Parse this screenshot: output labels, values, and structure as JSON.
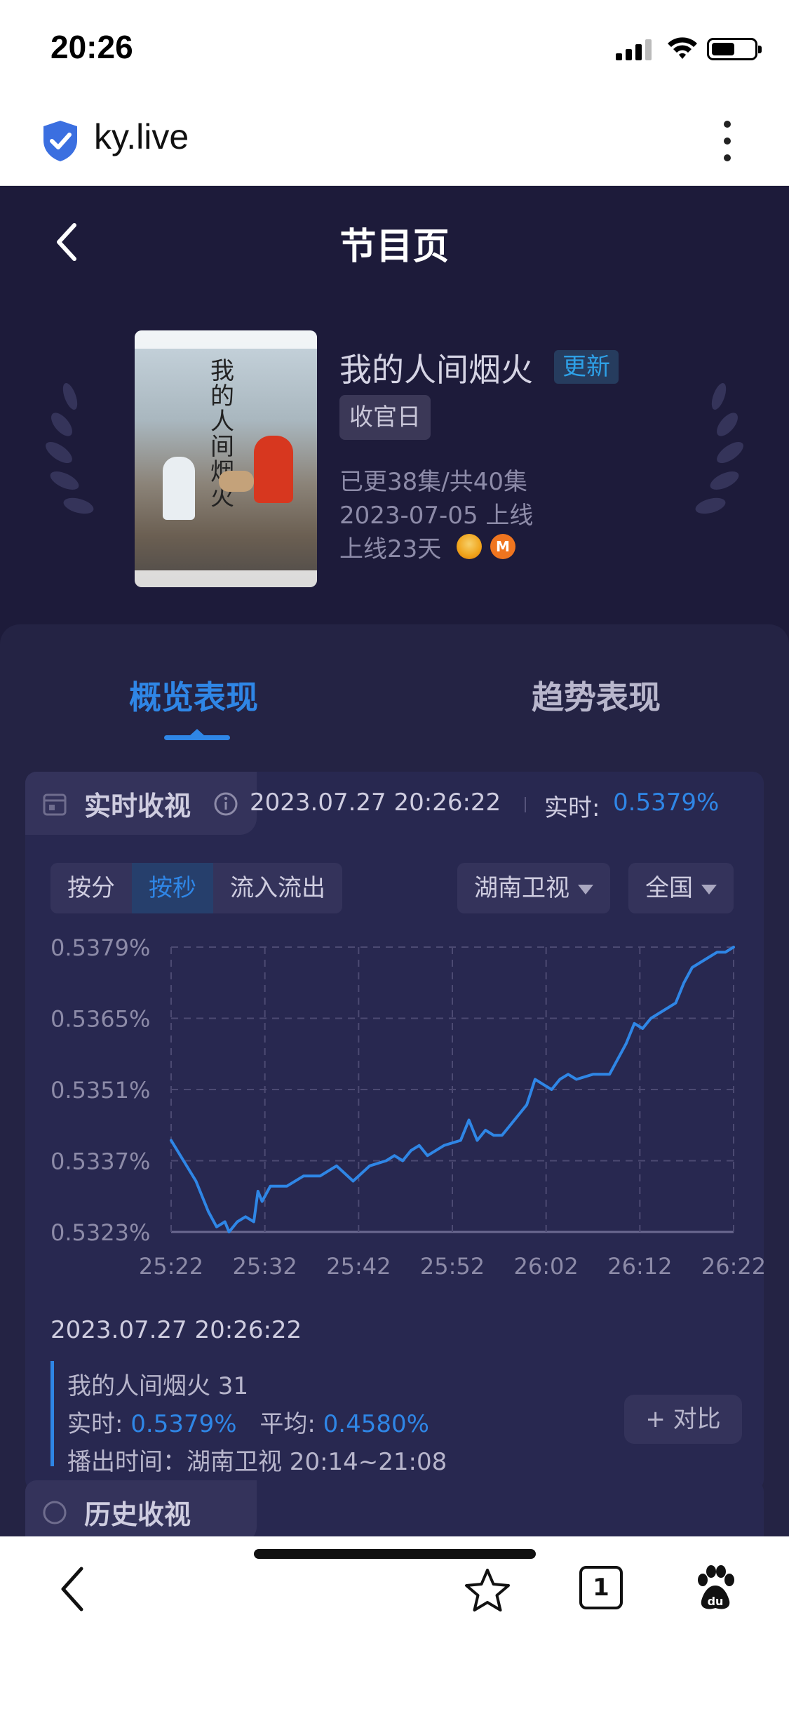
{
  "status_bar": {
    "time": "20:26",
    "battery_level": 0.55
  },
  "browser": {
    "url": "ky.live"
  },
  "header": {
    "title": "节目页"
  },
  "show": {
    "name": "我的人间烟火",
    "update_badge": "更新",
    "tag": "收官日",
    "episodes": "已更38集/共40集",
    "air_date": "2023-07-05 上线",
    "days_online": "上线23天",
    "poster_title": "我的人间烟火",
    "platform_icons": [
      "mango-tv-icon",
      "mgtv-icon"
    ]
  },
  "tabs": [
    {
      "label": "概览表现",
      "active": true
    },
    {
      "label": "趋势表现",
      "active": false
    }
  ],
  "realtime": {
    "title": "实时收视",
    "timestamp": "2023.07.27 20:26:22",
    "rt_label": "实时:",
    "rt_value": "0.5379%",
    "segments": [
      "按分",
      "按秒",
      "流入流出"
    ],
    "active_segment": 1,
    "channel": "湖南卫视",
    "region": "全国"
  },
  "chart_data": {
    "type": "line",
    "x_ticks": [
      "25:22",
      "25:32",
      "25:42",
      "25:52",
      "26:02",
      "26:12",
      "26:22"
    ],
    "y_ticks": [
      "0.5323%",
      "0.5337%",
      "0.5351%",
      "0.5365%",
      "0.5379%"
    ],
    "ylim": [
      0.5323,
      0.5379
    ],
    "grid": true,
    "line_color": "#2f86e6",
    "series": [
      {
        "values": [
          [
            0,
            0.5341
          ],
          [
            1.5,
            0.5337
          ],
          [
            3,
            0.5333
          ],
          [
            4.5,
            0.5327
          ],
          [
            5.5,
            0.5324
          ],
          [
            6.5,
            0.5325
          ],
          [
            7,
            0.5323
          ],
          [
            8,
            0.5325
          ],
          [
            9,
            0.5326
          ],
          [
            10,
            0.5325
          ],
          [
            10.5,
            0.5331
          ],
          [
            11,
            0.5329
          ],
          [
            12,
            0.5332
          ],
          [
            14,
            0.5332
          ],
          [
            16,
            0.5334
          ],
          [
            18,
            0.5334
          ],
          [
            20,
            0.5336
          ],
          [
            22,
            0.5333
          ],
          [
            24,
            0.5336
          ],
          [
            26,
            0.5337
          ],
          [
            27,
            0.5338
          ],
          [
            28,
            0.5337
          ],
          [
            29,
            0.5339
          ],
          [
            30,
            0.534
          ],
          [
            31,
            0.5338
          ],
          [
            33,
            0.534
          ],
          [
            35,
            0.5341
          ],
          [
            36,
            0.5345
          ],
          [
            37,
            0.5341
          ],
          [
            38,
            0.5343
          ],
          [
            39,
            0.5342
          ],
          [
            40,
            0.5342
          ],
          [
            41,
            0.5344
          ],
          [
            43,
            0.5348
          ],
          [
            44,
            0.5353
          ],
          [
            45,
            0.5352
          ],
          [
            46,
            0.5351
          ],
          [
            47,
            0.5353
          ],
          [
            48,
            0.5354
          ],
          [
            49,
            0.5353
          ],
          [
            51,
            0.5354
          ],
          [
            53,
            0.5354
          ],
          [
            55,
            0.536
          ],
          [
            56,
            0.5364
          ],
          [
            57,
            0.5363
          ],
          [
            58,
            0.5365
          ],
          [
            60,
            0.5367
          ],
          [
            61,
            0.5368
          ],
          [
            62,
            0.5372
          ],
          [
            63,
            0.5375
          ],
          [
            65,
            0.5377
          ],
          [
            66,
            0.5378
          ],
          [
            67,
            0.5378
          ],
          [
            68,
            0.5379
          ]
        ]
      }
    ],
    "x_range": [
      0,
      60
    ]
  },
  "detail": {
    "timestamp": "2023.07.27 20:26:22",
    "program": "我的人间烟火 31",
    "rt_label": "实时:",
    "rt_value": "0.5379%",
    "avg_label": "平均:",
    "avg_value": "0.4580%",
    "broadcast": "播出时间：湖南卫视 20:14~21:08",
    "compare_button": "+ 对比"
  },
  "history": {
    "title": "历史收视"
  },
  "toolbar": {
    "tab_count": "1"
  }
}
